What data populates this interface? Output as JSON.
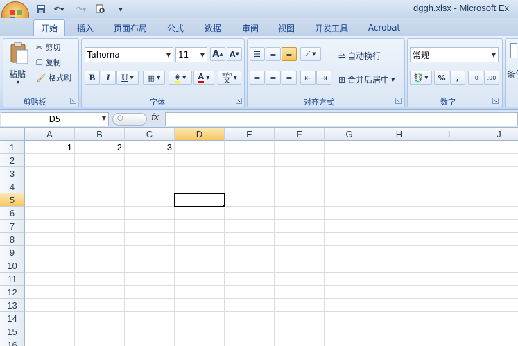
{
  "window": {
    "title": "dggh.xlsx - Microsoft Ex"
  },
  "tabs": [
    "开始",
    "插入",
    "页面布局",
    "公式",
    "数据",
    "审阅",
    "视图",
    "开发工具",
    "Acrobat"
  ],
  "ribbon": {
    "clipboard": {
      "paste": "粘贴",
      "cut": "剪切",
      "copy": "复制",
      "format_painter": "格式刷",
      "label": "剪贴板"
    },
    "font": {
      "name": "Tahoma",
      "size": "11",
      "grow": "A",
      "shrink": "A",
      "bold": "B",
      "italic": "I",
      "underline": "U",
      "phonetic": "wén",
      "phonetic_char": "文",
      "label": "字体"
    },
    "alignment": {
      "wrap": "自动换行",
      "merge": "合并后居中",
      "label": "对齐方式"
    },
    "number": {
      "format": "常规",
      "percent": "%",
      "comma": ",",
      "inc": ".0",
      "inc2": ".00",
      "label": "数字"
    },
    "cond": {
      "label": "条件"
    }
  },
  "formula_bar": {
    "cell_ref": "D5",
    "fx": "fx",
    "value": ""
  },
  "grid": {
    "columns": [
      "A",
      "B",
      "C",
      "D",
      "E",
      "F",
      "G",
      "H",
      "I",
      "J"
    ],
    "selected_column": "D",
    "rows": [
      "1",
      "2",
      "3",
      "4",
      "5",
      "6",
      "7",
      "8",
      "9",
      "10",
      "11",
      "12",
      "13",
      "14",
      "15",
      "16"
    ],
    "selected_row": "5",
    "cells": {
      "A1": "1",
      "B1": "2",
      "C1": "3"
    },
    "active_cell": "D5"
  },
  "colors": {
    "header_selected": "#f9c660",
    "gridline": "#dadcdd",
    "ribbon_text": "#15428b"
  }
}
